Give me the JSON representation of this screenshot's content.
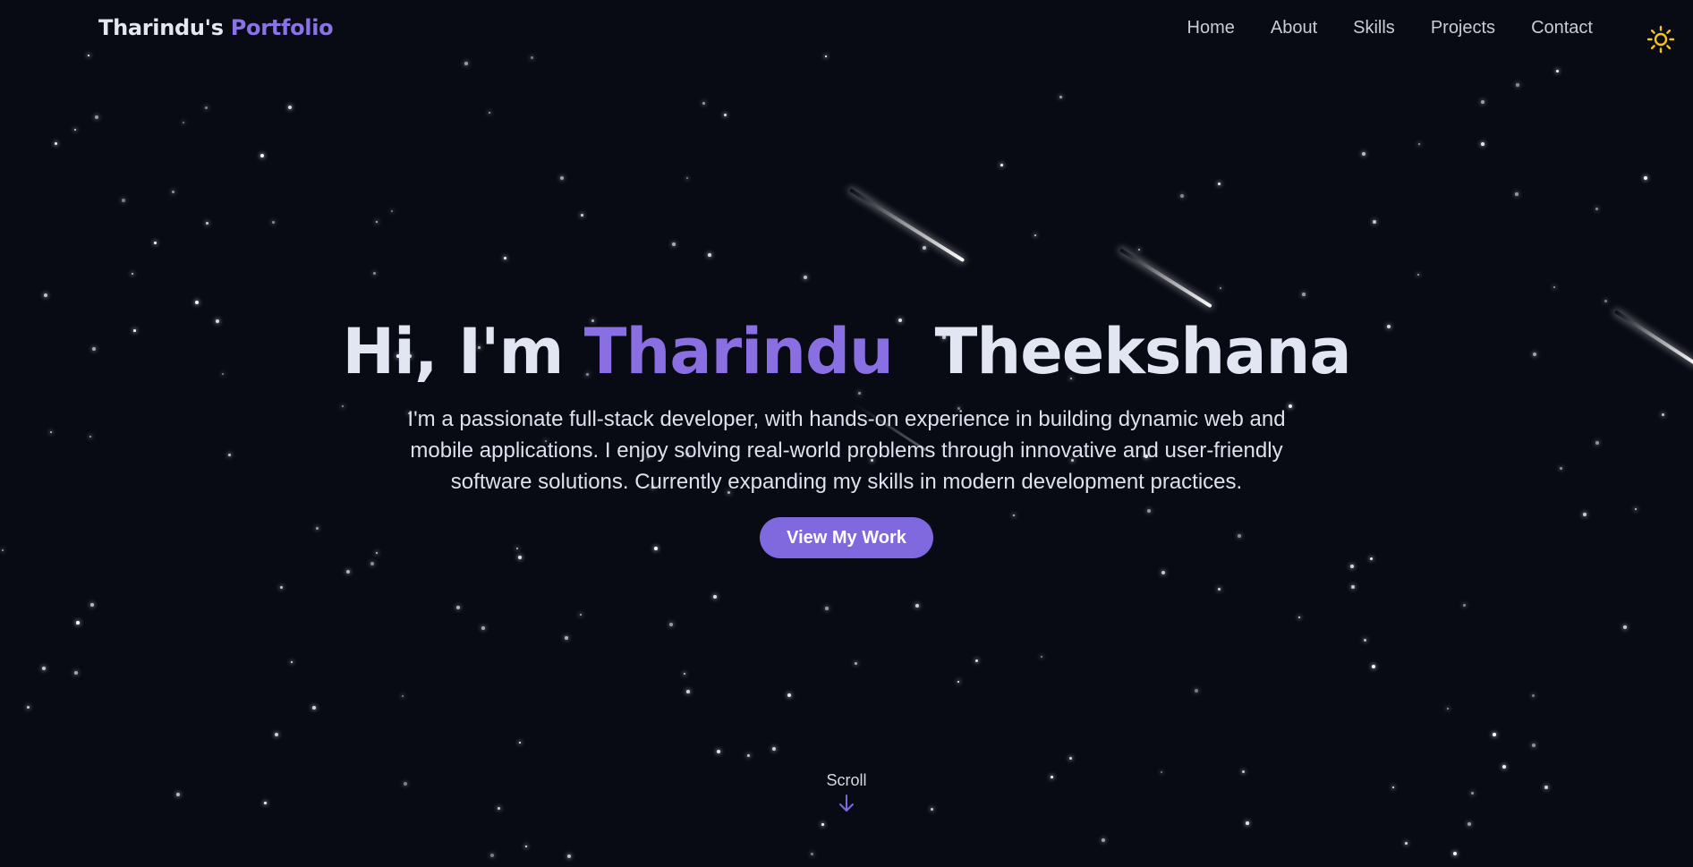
{
  "brand": {
    "name_part": "Tharindu's",
    "accent_part": "Portfolio"
  },
  "nav": {
    "items": [
      {
        "label": "Home"
      },
      {
        "label": "About"
      },
      {
        "label": "Skills"
      },
      {
        "label": "Projects"
      },
      {
        "label": "Contact"
      }
    ],
    "theme_toggle_icon": "sun-icon"
  },
  "hero": {
    "greeting": "Hi, I'm",
    "first_name": "Tharindu",
    "last_name": "Theekshana",
    "description": "I'm a passionate full-stack developer, with hands-on experience in building dynamic web and mobile applications. I enjoy solving real-world problems through innovative and user-friendly software solutions. Currently expanding my skills in modern development practices.",
    "cta_label": "View My Work"
  },
  "scroll": {
    "label": "Scroll",
    "icon": "arrow-down-icon"
  },
  "colors": {
    "background": "#080a14",
    "accent": "#8068df",
    "text": "#e2e6f3",
    "sun": "#f5c518"
  }
}
